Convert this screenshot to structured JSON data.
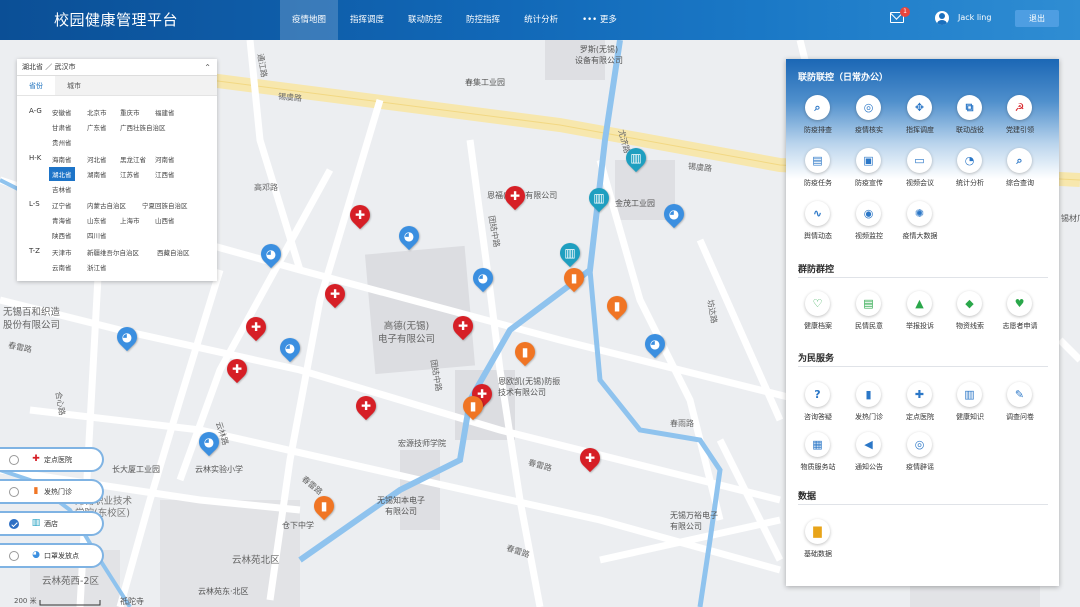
{
  "header": {
    "brand": "校园健康管理平台",
    "nav": [
      "疫情地图",
      "指挥调度",
      "联动防控",
      "防控指挥",
      "统计分析",
      "••• 更多"
    ],
    "notification_count": "1",
    "username": "Jack ling",
    "logout": "退出"
  },
  "province_picker": {
    "breadcrumb": "湖北省 ／ 武汉市",
    "tabs": [
      "省份",
      "城市"
    ],
    "groups": [
      {
        "key": "A-G",
        "rows": [
          [
            "安徽省",
            "北京市",
            "重庆市",
            "福建省"
          ],
          [
            "甘肃省",
            "广东省",
            "广西壮族自治区"
          ],
          [
            "贵州省"
          ]
        ]
      },
      {
        "key": "H-K",
        "rows": [
          [
            "海南省",
            "河北省",
            "黑龙江省",
            "河南省"
          ],
          [
            "湖北省",
            "湖南省",
            "江苏省",
            "江西省"
          ],
          [
            "吉林省"
          ]
        ]
      },
      {
        "key": "L-S",
        "rows": [
          [
            "辽宁省",
            "内蒙古自治区",
            "宁夏回族自治区"
          ],
          [
            "青海省",
            "山东省",
            "上海市",
            "山西省"
          ],
          [
            "陕西省",
            "四川省"
          ]
        ]
      },
      {
        "key": "T-Z",
        "rows": [
          [
            "天津市",
            "新疆维吾尔自治区",
            "西藏自治区"
          ],
          [
            "云南省",
            "浙江省"
          ]
        ]
      }
    ],
    "selected": "湖北省"
  },
  "legend": [
    {
      "label": "定点医院",
      "checked": false,
      "icon": "cross-icon",
      "color": "#d61f26"
    },
    {
      "label": "发热门诊",
      "checked": false,
      "icon": "thermometer-icon",
      "color": "#f07524"
    },
    {
      "label": "酒店",
      "checked": true,
      "icon": "hotel-icon",
      "color": "#1f9fc0"
    },
    {
      "label": "口罩发放点",
      "checked": false,
      "icon": "mask-icon",
      "color": "#3b8fe0"
    }
  ],
  "map": {
    "labels": [
      "罗斯(无锡)\n设备有限公司",
      "春集工业园",
      "恩福(无锡)有限公司",
      "金茂工业园",
      "高德(无锡)\n电子有限公司",
      "无锡百和织造\n股份有限公司",
      "恩欧凯(无锡)防振\n技术有限公司",
      "宏源技师学院",
      "长大厦工业园",
      "云林实验小学",
      "无锡知本电子\n有限公司",
      "无锡万裕电子\n有限公司",
      "仓下中学",
      "云林苑北区",
      "云林苑西-2区",
      "云林苑东·北区",
      "祗陀寺",
      "无锡职业技术\n学院(东校区)",
      "锡材厂",
      "200 米"
    ],
    "roads": [
      "锡虞路",
      "锡虞路",
      "高邓路",
      "春雷路",
      "春雷路",
      "春雷路",
      "团结中路",
      "团结中路",
      "合心路",
      "通江路",
      "云林路",
      "春雨路",
      "坊达路",
      "尤济路",
      "春雷路"
    ]
  },
  "panel": {
    "sections": [
      {
        "title": "联防联控（日常办公）",
        "items": [
          {
            "label": "防疫排查",
            "icon": "search-icon",
            "color": "#2b77c7"
          },
          {
            "label": "疫情核实",
            "icon": "verify-icon",
            "color": "#2b77c7"
          },
          {
            "label": "指挥调度",
            "icon": "dispatch-icon",
            "color": "#2b77c7"
          },
          {
            "label": "联动战役",
            "icon": "linkage-icon",
            "color": "#2b77c7"
          },
          {
            "label": "党建引领",
            "icon": "party-icon",
            "color": "#d8282d"
          },
          {
            "label": "防疫任务",
            "icon": "task-icon",
            "color": "#2b77c7"
          },
          {
            "label": "防疫宣传",
            "icon": "publicity-icon",
            "color": "#2b77c7"
          },
          {
            "label": "视频会议",
            "icon": "video-meeting-icon",
            "color": "#2b77c7"
          },
          {
            "label": "统计分析",
            "icon": "pie-chart-icon",
            "color": "#2b77c7"
          },
          {
            "label": "综合查询",
            "icon": "query-icon",
            "color": "#2b77c7"
          },
          {
            "label": "舆情动态",
            "icon": "trend-icon",
            "color": "#2b77c7"
          },
          {
            "label": "视频监控",
            "icon": "camera-icon",
            "color": "#2b77c7"
          },
          {
            "label": "疫情大数据",
            "icon": "bigdata-icon",
            "color": "#2b77c7"
          }
        ]
      },
      {
        "title": "群防群控",
        "items": [
          {
            "label": "健康档案",
            "icon": "health-record-icon",
            "color": "#2aa74a"
          },
          {
            "label": "民情民意",
            "icon": "opinion-icon",
            "color": "#2aa74a"
          },
          {
            "label": "举报投诉",
            "icon": "warning-icon",
            "color": "#2aa74a"
          },
          {
            "label": "物资线索",
            "icon": "supply-icon",
            "color": "#2aa74a"
          },
          {
            "label": "志愿者申请",
            "icon": "volunteer-icon",
            "color": "#2aa74a"
          }
        ]
      },
      {
        "title": "为民服务",
        "items": [
          {
            "label": "咨询答疑",
            "icon": "question-icon",
            "color": "#2b77c7"
          },
          {
            "label": "发热门诊",
            "icon": "thermometer-icon",
            "color": "#2b77c7"
          },
          {
            "label": "定点医院",
            "icon": "hospital-icon",
            "color": "#2b77c7"
          },
          {
            "label": "健康知识",
            "icon": "book-icon",
            "color": "#2b77c7"
          },
          {
            "label": "调查问卷",
            "icon": "survey-icon",
            "color": "#2b77c7"
          },
          {
            "label": "物质服务站",
            "icon": "store-icon",
            "color": "#2b77c7"
          },
          {
            "label": "通知公告",
            "icon": "announce-icon",
            "color": "#2b77c7"
          },
          {
            "label": "疫情辟谣",
            "icon": "rumor-icon",
            "color": "#2b77c7"
          }
        ]
      },
      {
        "title": "数据",
        "items": [
          {
            "label": "基础数据",
            "icon": "bar-chart-icon",
            "color": "#e8a419"
          }
        ]
      }
    ]
  }
}
